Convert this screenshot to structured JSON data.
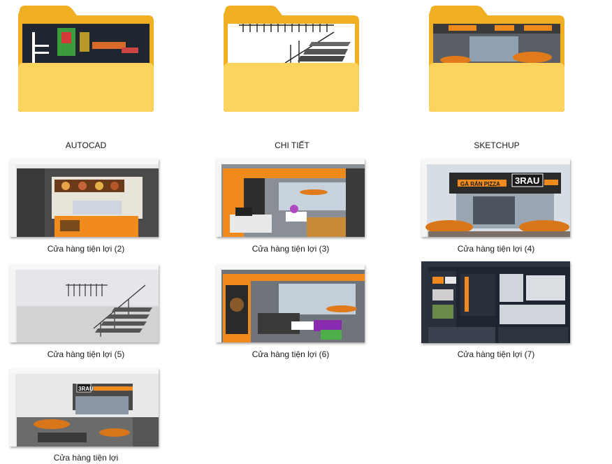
{
  "folders": [
    {
      "name": "AUTOCAD",
      "preview": "autocad-drawing"
    },
    {
      "name": "CHI TIẾT",
      "preview": "staircase-detail"
    },
    {
      "name": "SKETCHUP",
      "preview": "storefront-render"
    }
  ],
  "files": [
    {
      "name": "Cửa hàng tiện lợi (2)",
      "preview": "counter-render"
    },
    {
      "name": "Cửa hàng tiện lợi (3)",
      "preview": "interior-render"
    },
    {
      "name": "Cửa hàng tiện lợi (4)",
      "preview": "facade-render"
    },
    {
      "name": "Cửa hàng tiện lợi (5)",
      "preview": "staircase-model"
    },
    {
      "name": "Cửa hàng tiện lợi (6)",
      "preview": "dining-render"
    },
    {
      "name": "Cửa hàng tiện lợi (7)",
      "preview": "layout-sheet"
    },
    {
      "name": "Cửa hàng tiện lợi",
      "preview": "exterior-render"
    }
  ],
  "signage": {
    "brand": "3RAU",
    "menu": "GÀ RÁN   PIZZA"
  },
  "colors": {
    "folder_back": "#f5b82e",
    "folder_front": "#fcd35c",
    "accent_orange": "#f08a1c",
    "cad_bg": "#1f2630"
  }
}
